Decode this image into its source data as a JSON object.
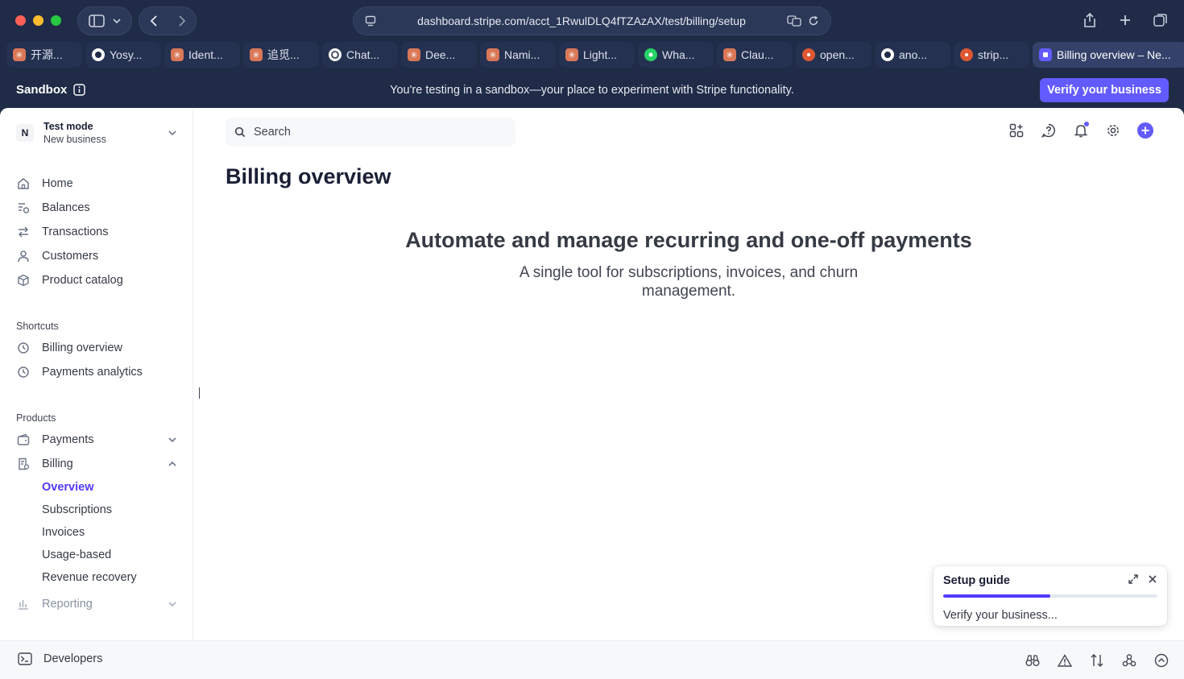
{
  "browser": {
    "url": "dashboard.stripe.com/acct_1RwulDLQ4fTZAzAX/test/billing/setup",
    "tabs": [
      {
        "label": "开源...",
        "icon": "claude-icon"
      },
      {
        "label": "Yosy...",
        "icon": "github-icon"
      },
      {
        "label": "Ident...",
        "icon": "claude-icon"
      },
      {
        "label": "追觅...",
        "icon": "claude-icon"
      },
      {
        "label": "Chat...",
        "icon": "openai-icon"
      },
      {
        "label": "Dee...",
        "icon": "claude-icon"
      },
      {
        "label": "Nami...",
        "icon": "claude-icon"
      },
      {
        "label": "Light...",
        "icon": "claude-icon"
      },
      {
        "label": "Wha...",
        "icon": "whatsapp-icon"
      },
      {
        "label": "Clau...",
        "icon": "claude-icon"
      },
      {
        "label": "open...",
        "icon": "duckduckgo-icon"
      },
      {
        "label": "ano...",
        "icon": "github-icon"
      },
      {
        "label": "strip...",
        "icon": "duckduckgo-icon"
      },
      {
        "label": "Billing overview – Ne...",
        "icon": "stripe-icon"
      }
    ]
  },
  "banner": {
    "sandbox_label": "Sandbox",
    "message": "You're testing in a sandbox—your place to experiment with Stripe functionality.",
    "verify_label": "Verify your business"
  },
  "account": {
    "avatar": "N",
    "mode": "Test mode",
    "business": "New business"
  },
  "nav": {
    "home": "Home",
    "balances": "Balances",
    "transactions": "Transactions",
    "customers": "Customers",
    "product_catalog": "Product catalog",
    "shortcuts_heading": "Shortcuts",
    "billing_overview": "Billing overview",
    "payments_analytics": "Payments analytics",
    "products_heading": "Products",
    "payments": "Payments",
    "billing": "Billing",
    "billing_sub": {
      "overview": "Overview",
      "subscriptions": "Subscriptions",
      "invoices": "Invoices",
      "usage_based": "Usage-based",
      "revenue_recovery": "Revenue recovery"
    },
    "reporting": "Reporting"
  },
  "search": {
    "placeholder": "Search"
  },
  "main": {
    "page_title": "Billing overview",
    "hero_title": "Automate and manage recurring and one-off payments",
    "hero_subtitle": "A single tool for subscriptions, invoices, and churn management."
  },
  "setup_guide": {
    "title": "Setup guide",
    "step": "Verify your business...",
    "progress": 0.5
  },
  "footer": {
    "developers": "Developers"
  },
  "colors": {
    "accent": "#635bff",
    "chrome": "#1f2b47"
  }
}
